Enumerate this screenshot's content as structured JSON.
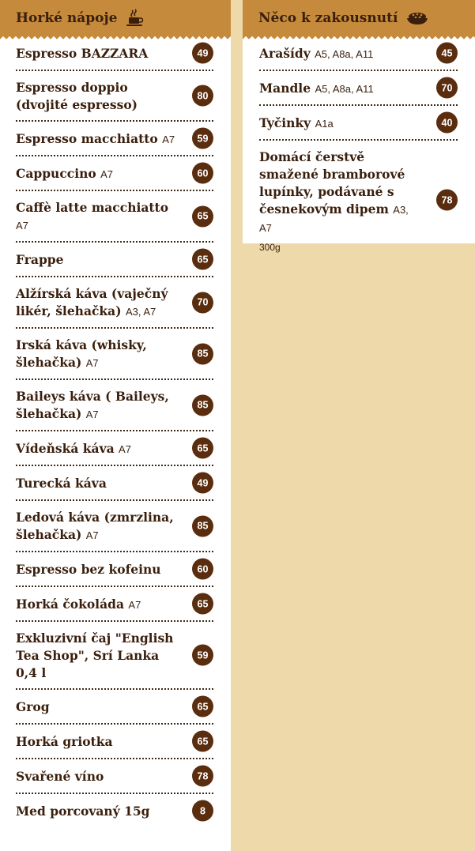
{
  "hot_drinks": {
    "title": "Horké nápoje",
    "icon": "coffee-cup-icon",
    "items": [
      {
        "name": "Espresso BAZZARA",
        "allergens": "",
        "price": "49"
      },
      {
        "name": "Espresso doppio (dvojité espresso)",
        "allergens": "",
        "price": "80"
      },
      {
        "name": "Espresso macchiatto",
        "allergens": "A7",
        "price": "59"
      },
      {
        "name": "Cappuccino",
        "allergens": "A7",
        "price": "60"
      },
      {
        "name": "Caffè latte macchiatto",
        "allergens": "A7",
        "price": "65"
      },
      {
        "name": "Frappe",
        "allergens": "",
        "price": "65"
      },
      {
        "name": "Alžírská káva (vaječný likér, šlehačka)",
        "allergens": "A3, A7",
        "price": "70"
      },
      {
        "name": "Irská káva (whisky, šlehačka)",
        "allergens": "A7",
        "price": "85"
      },
      {
        "name": "Baileys káva ( Baileys, šlehačka)",
        "allergens": "A7",
        "price": "85"
      },
      {
        "name": "Vídeňská káva",
        "allergens": "A7",
        "price": "65"
      },
      {
        "name": "Turecká káva",
        "allergens": "",
        "price": "49"
      },
      {
        "name": "Ledová káva (zmrzlina, šlehačka)",
        "allergens": "A7",
        "price": "85"
      },
      {
        "name": "Espresso bez kofeinu",
        "allergens": "",
        "price": "60"
      },
      {
        "name": "Horká čokoláda",
        "allergens": "A7",
        "price": "65"
      },
      {
        "name": "Exkluzivní čaj \"English Tea Shop\", Srí Lanka 0,4 l",
        "allergens": "",
        "price": "59"
      },
      {
        "name": "Grog",
        "allergens": "",
        "price": "65"
      },
      {
        "name": "Horká griotka",
        "allergens": "",
        "price": "65"
      },
      {
        "name": "Svařené víno",
        "allergens": "",
        "price": "78"
      },
      {
        "name": "Med porcovaný 15g",
        "allergens": "",
        "price": "8"
      }
    ]
  },
  "snacks": {
    "title": "Něco k zakousnutí",
    "icon": "snack-bowl-icon",
    "items": [
      {
        "name": "Arašídy",
        "allergens": "A5, A8a, A11",
        "price": "45",
        "weight": ""
      },
      {
        "name": "Mandle",
        "allergens": "A5, A8a, A11",
        "price": "70",
        "weight": ""
      },
      {
        "name": "Tyčinky",
        "allergens": "A1a",
        "price": "40",
        "weight": ""
      },
      {
        "name": "Domácí čerstvě smažené bramborové lupínky, podávané s česnekovým dipem",
        "allergens": "A3, A7",
        "price": "78",
        "weight": "300g"
      }
    ]
  },
  "colors": {
    "header_bg": "#c58a3c",
    "page_bg": "#eed9ab",
    "price_badge": "#5a2d0f",
    "text": "#3a1f0d"
  }
}
